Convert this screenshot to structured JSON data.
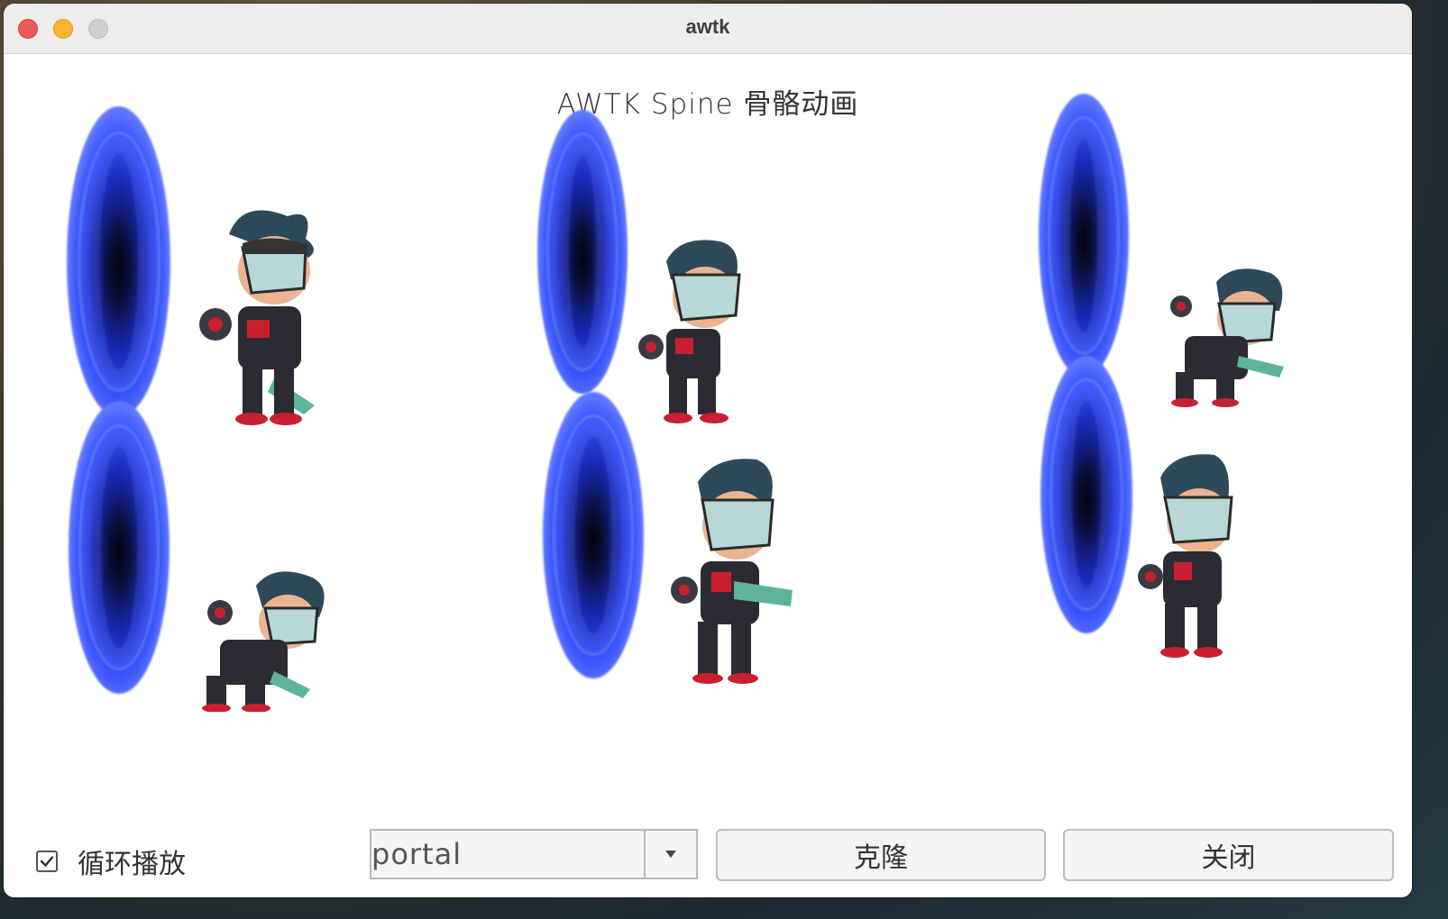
{
  "window": {
    "title": "awtk",
    "controls": [
      "close-button",
      "minimize-button",
      "zoom-button"
    ]
  },
  "content": {
    "heading": "AWTK Spine 骨骼动画"
  },
  "controls": {
    "loop_label": "循环播放",
    "loop_checked": true,
    "animation_select_value": "portal",
    "clone_label": "克隆",
    "close_label": "关闭"
  },
  "colors": {
    "portal_blue": "#3a55ff",
    "titlebar": "#efedeb",
    "close_light": "#ee5a52",
    "minimize_light": "#f5b52f",
    "zoom_light": "#d0cfcd"
  }
}
